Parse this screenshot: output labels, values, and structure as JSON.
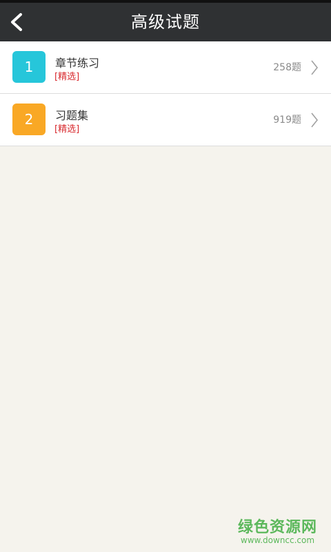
{
  "header": {
    "title": "高级试题",
    "back_icon": "chevron-left-icon"
  },
  "items": [
    {
      "number": "1",
      "name": "章节练习",
      "tag": "[精选]",
      "count": "258题",
      "badge_color": "#26c6da",
      "chevron_icon": "chevron-right-icon"
    },
    {
      "number": "2",
      "name": "习题集",
      "tag": "[精选]",
      "count": "919题",
      "badge_color": "#f9a825",
      "chevron_icon": "chevron-right-icon"
    }
  ],
  "watermark": {
    "title": "绿色资源网",
    "url": "www.downcc.com"
  }
}
